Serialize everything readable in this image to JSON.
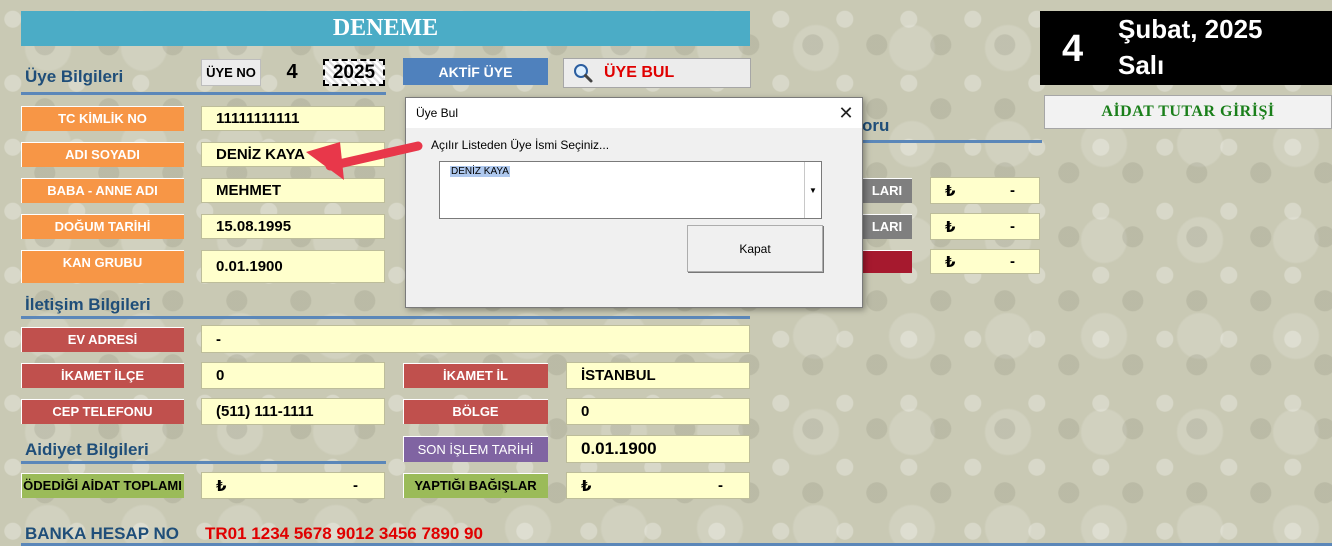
{
  "title": "DENEME",
  "header": {
    "uye_no_label": "ÜYE NO",
    "uye_no_value": "4",
    "year": "2025",
    "aktif_uye": "AKTİF ÜYE",
    "uye_bul": "ÜYE BUL"
  },
  "date": {
    "day": "4",
    "month_year": "Şubat, 2025",
    "weekday": "Salı"
  },
  "aidat_button": "AİDAT TUTAR GİRİŞİ",
  "sections": {
    "uye": "Üye Bilgileri",
    "iletisim": "İletişim Bilgileri",
    "aidiyet": "Aidiyet Bilgileri"
  },
  "uye_fields": [
    {
      "label": "TC KİMLİK NO",
      "value": "11111111111"
    },
    {
      "label": "ADI SOYADI",
      "value": "DENİZ KAYA"
    },
    {
      "label": "BABA - ANNE ADI",
      "value": "MEHMET"
    },
    {
      "label": "DOĞUM TARİHİ",
      "value": "15.08.1995"
    },
    {
      "label": "KAN GRUBU",
      "value": "0.01.1900"
    }
  ],
  "iletisim": {
    "ev_adresi": {
      "label": "EV ADRESİ",
      "value": "-"
    },
    "ikamet_ilce": {
      "label": "İKAMET İLÇE",
      "value": "0"
    },
    "ikamet_il": {
      "label": "İKAMET İL",
      "value": "İSTANBUL"
    },
    "cep": {
      "label": "CEP TELEFONU",
      "value": "(511) 111-1111"
    },
    "bolge": {
      "label": "BÖLGE",
      "value": "0"
    }
  },
  "son_islem": {
    "label": "SON İŞLEM TARİHİ",
    "value": "0.01.1900"
  },
  "aidiyet": {
    "odedigi": {
      "label": "ÖDEDİĞİ AİDAT TOPLAMI",
      "currency": "₺",
      "value": "-"
    },
    "bagis": {
      "label": "YAPTIĞI BAĞIŞLAR",
      "currency": "₺",
      "value": "-"
    }
  },
  "banka": {
    "label": "BANKA HESAP NO",
    "iban": "TR01 1234 5678 9012 3456 7890 90"
  },
  "right_panel": {
    "heading_fragment": "oru",
    "rows": [
      {
        "label": "LARI",
        "currency": "₺",
        "value": "-"
      },
      {
        "label": "LARI",
        "currency": "₺",
        "value": "-"
      },
      {
        "label": "",
        "currency": "₺",
        "value": "-"
      }
    ]
  },
  "dialog": {
    "title": "Üye Bul",
    "close": "✕",
    "prompt": "Açılır Listeden Üye İsmi Seçiniz...",
    "selected": "DENİZ KAYA",
    "close_button": "Kapat"
  },
  "colors": {
    "title_bar": "#4bacc6",
    "orange_label": "#f79646",
    "red_label": "#c0504d",
    "purple_label": "#8064a2",
    "green_label": "#9bbb59",
    "value_bg": "#ffffcc",
    "arrow": "#e8374a"
  }
}
